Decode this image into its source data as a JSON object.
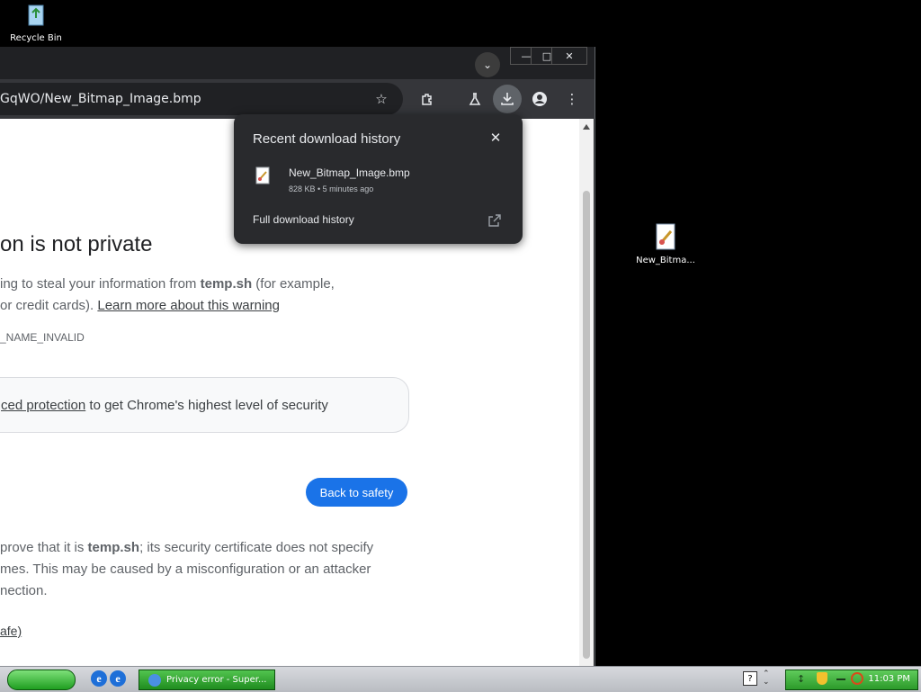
{
  "desktop": {
    "icons": [
      {
        "label": "Recycle Bin"
      },
      {
        "label": "New_Bitma..."
      }
    ]
  },
  "browser": {
    "url_text": "GqWO/New_Bitmap_Image.bmp",
    "page": {
      "heading": "on is not private",
      "para1_part1": "ing to steal your information from ",
      "para1_domain": "temp.sh",
      "para1_part2": " (for example,",
      "para1_line2": "or credit cards). ",
      "learn_more": "Learn more about this warning",
      "error_code": "_NAME_INVALID",
      "promo_link": "ced protection",
      "promo_text": " to get Chrome's highest level of security",
      "back_button": "Back to safety",
      "details_line1_a": "prove that it is ",
      "details_line1_domain": "temp.sh",
      "details_line1_b": "; its security certificate does not specify",
      "details_line2": "mes. This may be caused by a misconfiguration or an attacker",
      "details_line3": "nection.",
      "proceed_link": "afe)"
    },
    "downloads_popup": {
      "title": "Recent download history",
      "item_name": "New_Bitmap_Image.bmp",
      "item_meta": "828 KB • 5 minutes ago",
      "full_history": "Full download history"
    }
  },
  "taskbar": {
    "task_label": "Privacy error - Super...",
    "clock": "11:03 PM"
  }
}
